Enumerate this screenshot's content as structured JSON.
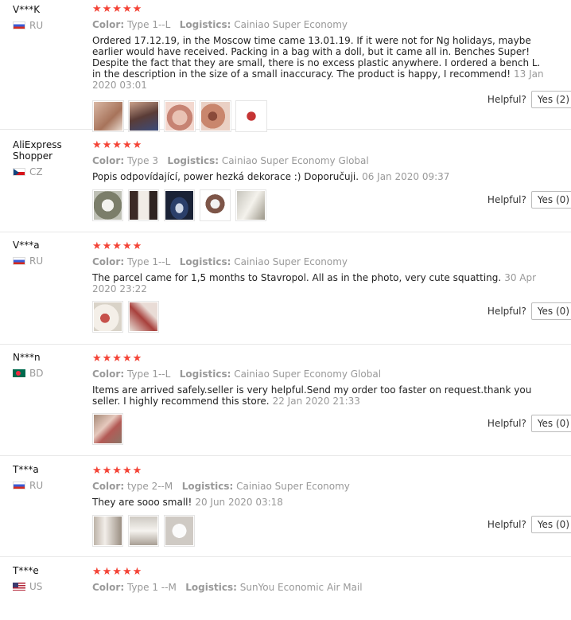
{
  "stars": "★★★★★",
  "labels": {
    "color": "Color:",
    "logistics": "Logistics:",
    "helpful": "Helpful?"
  },
  "reviews": [
    {
      "user": "V***K",
      "country": "RU",
      "color": "Type 1--L",
      "logistics": "Cainiao Super Economy",
      "text": "Ordered 17.12.19, in the Moscow time came 13.01.19. If it were not for Ng holidays, maybe earlier would have received. Packing in a bag with a doll, but it came all in. Benches Super! Despite the fact that they are small, there is no excess plastic anywhere. I ordered a bench L. in the description in the size of a small inaccuracy. The product is happy, I recommend!",
      "date": "13 Jan 2020 03:01",
      "yes": "Yes (2)"
    },
    {
      "user": "AliExpress Shopper",
      "country": "CZ",
      "color": "Type 3",
      "logistics": "Cainiao Super Economy Global",
      "text": "Popis odpovídající, power hezká dekorace :) Doporučuji.",
      "date": "06 Jan 2020 09:37",
      "yes": "Yes (0)"
    },
    {
      "user": "V***a",
      "country": "RU",
      "color": "Type 1--L",
      "logistics": "Cainiao Super Economy",
      "text": "The parcel came for 1,5 months to Stavropol. All as in the photo, very cute squatting.",
      "date": "30 Apr 2020 23:22",
      "yes": "Yes (0)"
    },
    {
      "user": "N***n",
      "country": "BD",
      "color": "Type 1--L",
      "logistics": "Cainiao Super Economy Global",
      "text": "Items are arrived safely.seller is very helpful.Send my order too faster on request.thank you seller. I highly recommend this store.",
      "date": "22 Jan 2020 21:33",
      "yes": "Yes (0)"
    },
    {
      "user": "T***a",
      "country": "RU",
      "color": "type 2--M",
      "logistics": "Cainiao Super Economy",
      "text": "They are sooo small!",
      "date": "20 Jun 2020 03:18",
      "yes": "Yes (0)"
    },
    {
      "user": "T***e",
      "country": "US",
      "color": "Type 1 --M",
      "logistics": "SunYou Economic Air Mail",
      "text": "",
      "date": "",
      "yes": ""
    }
  ]
}
